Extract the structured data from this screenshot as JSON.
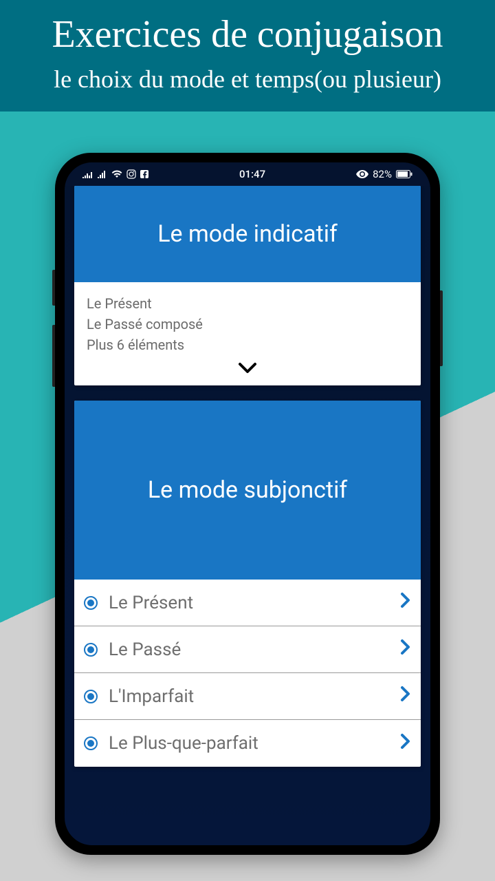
{
  "header": {
    "title": "Exercices de conjugaison",
    "subtitle": "le choix du mode et temps(ou plusieur)"
  },
  "status": {
    "time": "01:47",
    "battery_pct": "82%"
  },
  "cards": [
    {
      "title": "Le mode indicatif",
      "summary": [
        "Le Présent",
        "Le Passé composé",
        "Plus 6 éléments"
      ]
    },
    {
      "title": "Le mode subjonctif",
      "items": [
        "Le Présent",
        "Le Passé",
        "L'Imparfait",
        "Le Plus-que-parfait"
      ]
    }
  ]
}
